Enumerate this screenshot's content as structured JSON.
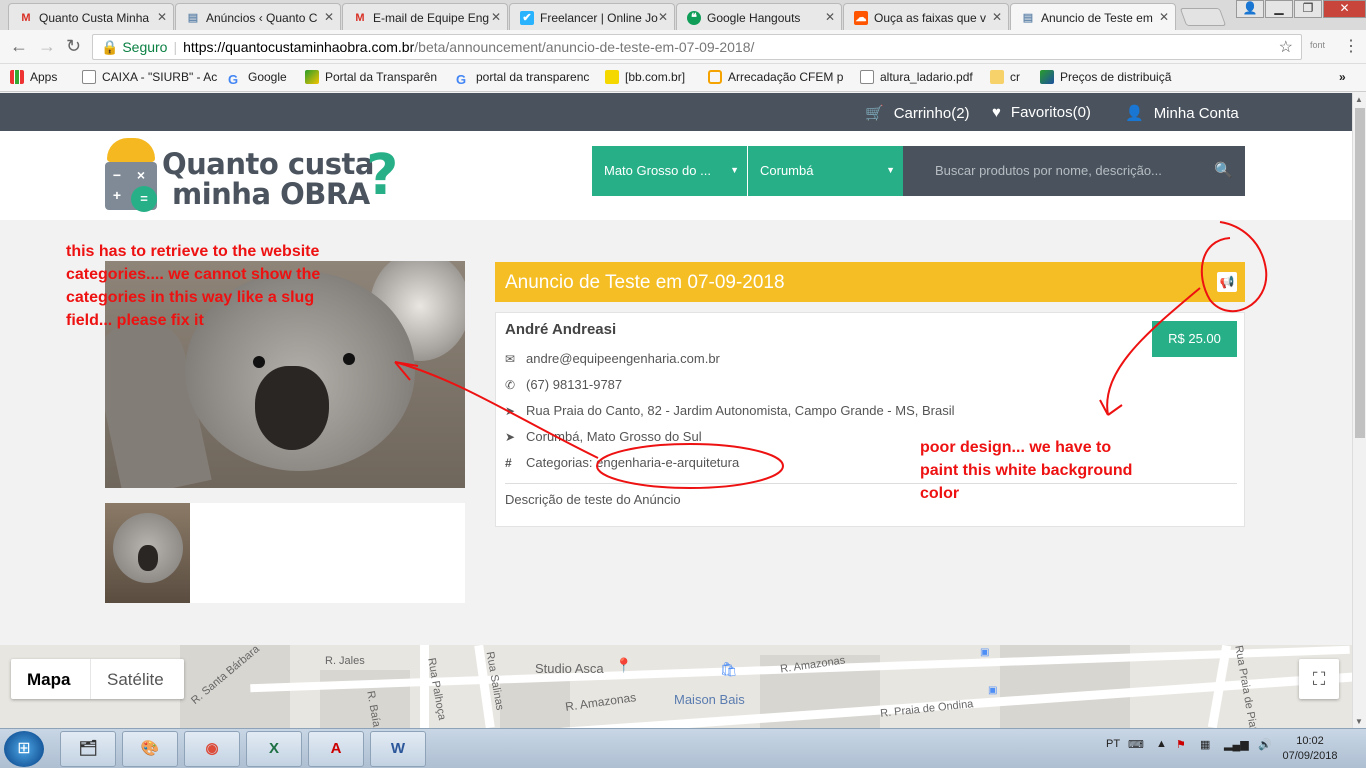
{
  "browser": {
    "tabs": [
      {
        "title": "Quanto Custa Minha",
        "icon": "gmail-icon",
        "fav": "M"
      },
      {
        "title": "Anúncios ‹ Quanto C",
        "icon": "page-icon",
        "fav": "▤"
      },
      {
        "title": "E-mail de Equipe Eng",
        "icon": "gmail-icon",
        "fav": "M"
      },
      {
        "title": "Freelancer | Online Jo",
        "icon": "freelancer-icon",
        "fav": "✔"
      },
      {
        "title": "Google Hangouts",
        "icon": "hangouts-icon",
        "fav": "❝"
      },
      {
        "title": "Ouça as faixas que v",
        "icon": "soundcloud-icon",
        "fav": "☁"
      },
      {
        "title": "Anuncio de Teste em",
        "icon": "page-icon",
        "fav": "▤"
      }
    ],
    "secure_label": "Seguro",
    "url_host": "https://quantocustaminhaobra.com.br",
    "url_path": "/beta/announcement/anuncio-de-teste-em-07-09-2018/",
    "extension_label": "font",
    "bookmarks": [
      {
        "label": "Apps",
        "icon": "apps-grid-icon"
      },
      {
        "label": "CAIXA - \"SIURB\" - Ac",
        "icon": "page-icon"
      },
      {
        "label": "Google",
        "icon": "google-icon"
      },
      {
        "label": "Portal da Transparên",
        "icon": "flag-icon"
      },
      {
        "label": "portal da transparenc",
        "icon": "google-icon"
      },
      {
        "label": "[bb.com.br]",
        "icon": "bb-icon"
      },
      {
        "label": "Arrecadação CFEM p",
        "icon": "cfem-icon"
      },
      {
        "label": "altura_ladario.pdf",
        "icon": "page-icon"
      },
      {
        "label": "cr",
        "icon": "folder-icon"
      },
      {
        "label": "Preços de distribuiçã",
        "icon": "flag-icon"
      }
    ],
    "more_label": "»"
  },
  "site": {
    "nav": {
      "cart": "Carrinho(2)",
      "favorites": "Favoritos(0)",
      "account": "Minha Conta"
    },
    "logo": {
      "line1": "Quanto custa",
      "line2": "minha OBRA",
      "mark": "?"
    },
    "state_select": "Mato Grosso do ...",
    "city_select": "Corumbá",
    "search_placeholder": "Buscar produtos por nome, descrição..."
  },
  "announcement": {
    "title": "Anuncio de Teste em 07-09-2018",
    "owner": "André Andreasi",
    "price": "R$ 25.00",
    "email": "andre@equipeengenharia.com.br",
    "phone": "(67) 98131-9787",
    "address": "Rua Praia do Canto, 82 - Jardim Autonomista, Campo Grande - MS, Brasil",
    "location": "Corumbá, Mato Grosso do Sul",
    "categories_label": "Categorias:",
    "categories_value": "engenharia-e-arquitetura",
    "description": "Descrição de teste do Anúncio"
  },
  "map": {
    "btn_map": "Mapa",
    "btn_satellite": "Satélite",
    "labels": [
      "R. Santa Bárbara",
      "R. Jales",
      "Rua Palhoça",
      "Rua Salinas",
      "Studio Asca",
      "R. Amazonas",
      "Maison Bais",
      "R. Amazonas",
      "R. Praia de Ondina",
      "R. Baía",
      "Rua Praia de Piatã"
    ]
  },
  "annotations": {
    "note1": [
      "this has to retrieve to the website",
      "categories.... we cannot show the",
      "categories in this way like a slug",
      "field... please fix it"
    ],
    "note2": [
      "poor design... we have to",
      "paint this white background",
      "color"
    ],
    "color": "#e11111"
  },
  "taskbar": {
    "apps": [
      {
        "icon": "explorer-icon",
        "glyph": "🗂"
      },
      {
        "icon": "paint-icon",
        "glyph": "🎨"
      },
      {
        "icon": "chrome-icon",
        "glyph": "◉"
      },
      {
        "icon": "excel-icon",
        "glyph": "X"
      },
      {
        "icon": "autocad-icon",
        "glyph": "A"
      },
      {
        "icon": "word-icon",
        "glyph": "W"
      }
    ],
    "language": "PT",
    "time": "10:02",
    "date": "07/09/2018"
  }
}
